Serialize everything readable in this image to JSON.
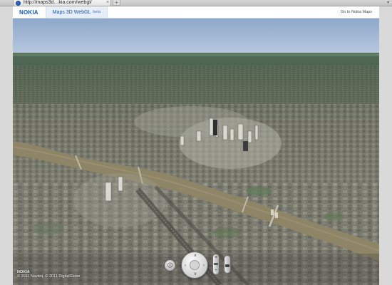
{
  "browser": {
    "tab_url": "http://maps3d…kia.com/webgl/",
    "tab_close_label": "×",
    "new_tab_label": "+",
    "overflow_label": "▾"
  },
  "app": {
    "brand": "NOKIA",
    "active_tab": "Maps 3D WebGL",
    "active_tab_badge": "beta",
    "external_link": "Go to Nokia Maps"
  },
  "map": {
    "attribution_logo": "NOKIA",
    "attribution_text": "© 2011 Navteq, © 2011 DigitalGlobe"
  },
  "controls": {
    "compass": "☹",
    "pan_up": "∧",
    "pan_down": "∨",
    "pan_left": "‹",
    "pan_right": "›",
    "zoom_in": "+",
    "zoom_out": "−"
  },
  "colors": {
    "brand_blue": "#1a58b3",
    "river": "#8e8466",
    "sky": "#a4b8d3"
  },
  "icons": {
    "favicon": "globe-icon",
    "compass": "compass-icon",
    "pan": "pan-control-icon",
    "zoom": "zoom-slider-icon",
    "tilt": "tilt-slider-icon"
  }
}
